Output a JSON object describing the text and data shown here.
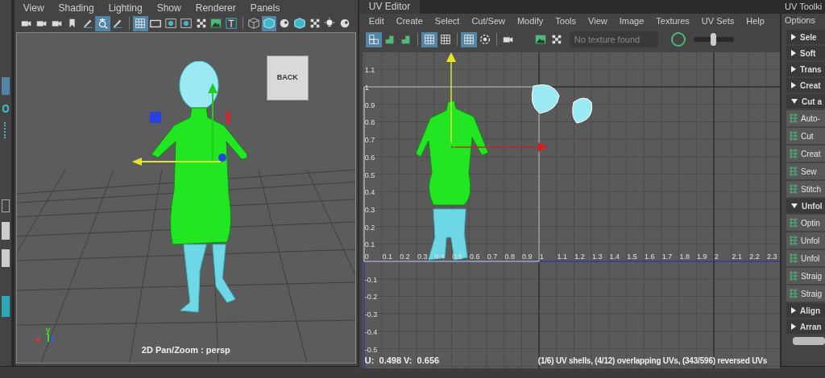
{
  "viewport": {
    "menu": [
      "View",
      "Shading",
      "Lighting",
      "Show",
      "Renderer",
      "Panels"
    ],
    "toolbar": [
      {
        "kind": "camera",
        "selected": false
      },
      {
        "kind": "camera",
        "selected": false
      },
      {
        "kind": "camera",
        "selected": false
      },
      {
        "kind": "bookmark",
        "selected": false
      },
      {
        "kind": "pencil",
        "selected": false
      },
      {
        "kind": "pan",
        "selected": true
      },
      {
        "kind": "pencil",
        "selected": false
      },
      {
        "kind": "sep"
      },
      {
        "kind": "grid",
        "selected": true
      },
      {
        "kind": "gate",
        "selected": false
      },
      {
        "kind": "dot",
        "selected": false
      },
      {
        "kind": "dot",
        "selected": false
      },
      {
        "kind": "checker",
        "selected": false
      },
      {
        "kind": "image",
        "selected": false
      },
      {
        "kind": "text",
        "selected": false
      },
      {
        "kind": "sep"
      },
      {
        "kind": "wirecube",
        "selected": false
      },
      {
        "kind": "cube",
        "selected": true
      },
      {
        "kind": "sphere",
        "selected": false
      },
      {
        "kind": "cube",
        "selected": false
      },
      {
        "kind": "checker",
        "selected": false
      },
      {
        "kind": "light",
        "selected": false
      },
      {
        "kind": "sphere",
        "selected": false
      }
    ],
    "view_cube": "BACK",
    "axes": [
      "x",
      "y",
      "z"
    ],
    "camera_label": "2D Pan/Zoom : persp"
  },
  "uv_editor": {
    "title": "UV Editor",
    "menu": [
      "Edit",
      "Create",
      "Select",
      "Cut/Sew",
      "Modify",
      "Tools",
      "View",
      "Image",
      "Textures",
      "UV Sets",
      "Help"
    ],
    "toolbar": [
      {
        "kind": "layout",
        "selected": true
      },
      {
        "kind": "stairs",
        "selected": false
      },
      {
        "kind": "stairs",
        "selected": false
      },
      {
        "kind": "sep"
      },
      {
        "kind": "grid",
        "selected": true
      },
      {
        "kind": "grid",
        "selected": false
      },
      {
        "kind": "sep"
      },
      {
        "kind": "grid",
        "selected": true
      },
      {
        "kind": "ring",
        "selected": false
      },
      {
        "kind": "sep"
      },
      {
        "kind": "camera",
        "selected": false
      },
      {
        "kind": "gap"
      },
      {
        "kind": "image",
        "selected": false
      },
      {
        "kind": "checker",
        "selected": false
      }
    ],
    "texture": {
      "placeholder": "No texture found"
    },
    "exposure": {
      "level": 0.5
    },
    "u_labels": [
      "0",
      "0.1",
      "0.2",
      "0.3",
      "0.4",
      "0.5",
      "0.6",
      "0.7",
      "0.8",
      "0.9",
      "1",
      "1.1",
      "1.2",
      "1.3",
      "1.4",
      "1.5",
      "1.6",
      "1.7",
      "1.8",
      "1.9",
      "2",
      "2.1",
      "2.2",
      "2.3"
    ],
    "v_labels": [
      "1.1",
      "1",
      "0.9",
      "0.8",
      "0.7",
      "0.6",
      "0.5",
      "0.4",
      "0.3",
      "0.2",
      "0.1",
      "-0.1",
      "-0.2",
      "-0.3",
      "-0.4",
      "-0.5"
    ],
    "coords": "U:  0.498 V:  0.656",
    "stats": "(1/6) UV shells, (4/12) overlapping UVs, (343/596) reversed UVs"
  },
  "uv_toolkit": {
    "title": "UV Toolki",
    "menu": "Options",
    "items": [
      {
        "kind": "section",
        "label": "Sele",
        "expanded": false
      },
      {
        "kind": "section",
        "label": "Soft",
        "expanded": false
      },
      {
        "kind": "section",
        "label": "Trans",
        "expanded": false
      },
      {
        "kind": "section",
        "label": "Creat",
        "expanded": false
      },
      {
        "kind": "section",
        "label": "Cut a",
        "expanded": true
      },
      {
        "kind": "tool",
        "label": "Auto-"
      },
      {
        "kind": "tool",
        "label": "Cut"
      },
      {
        "kind": "tool",
        "label": "Creat"
      },
      {
        "kind": "tool",
        "label": "Sew"
      },
      {
        "kind": "tool",
        "label": "Stitch"
      },
      {
        "kind": "section",
        "label": "Unfol",
        "expanded": true
      },
      {
        "kind": "tool",
        "label": "Optin"
      },
      {
        "kind": "tool",
        "label": "Unfol"
      },
      {
        "kind": "tool",
        "label": "Unfol"
      },
      {
        "kind": "tool",
        "label": "Straig"
      },
      {
        "kind": "tool",
        "label": "Straig"
      },
      {
        "kind": "section",
        "label": "Align",
        "expanded": false
      },
      {
        "kind": "section",
        "label": "Arran",
        "expanded": false
      }
    ]
  }
}
